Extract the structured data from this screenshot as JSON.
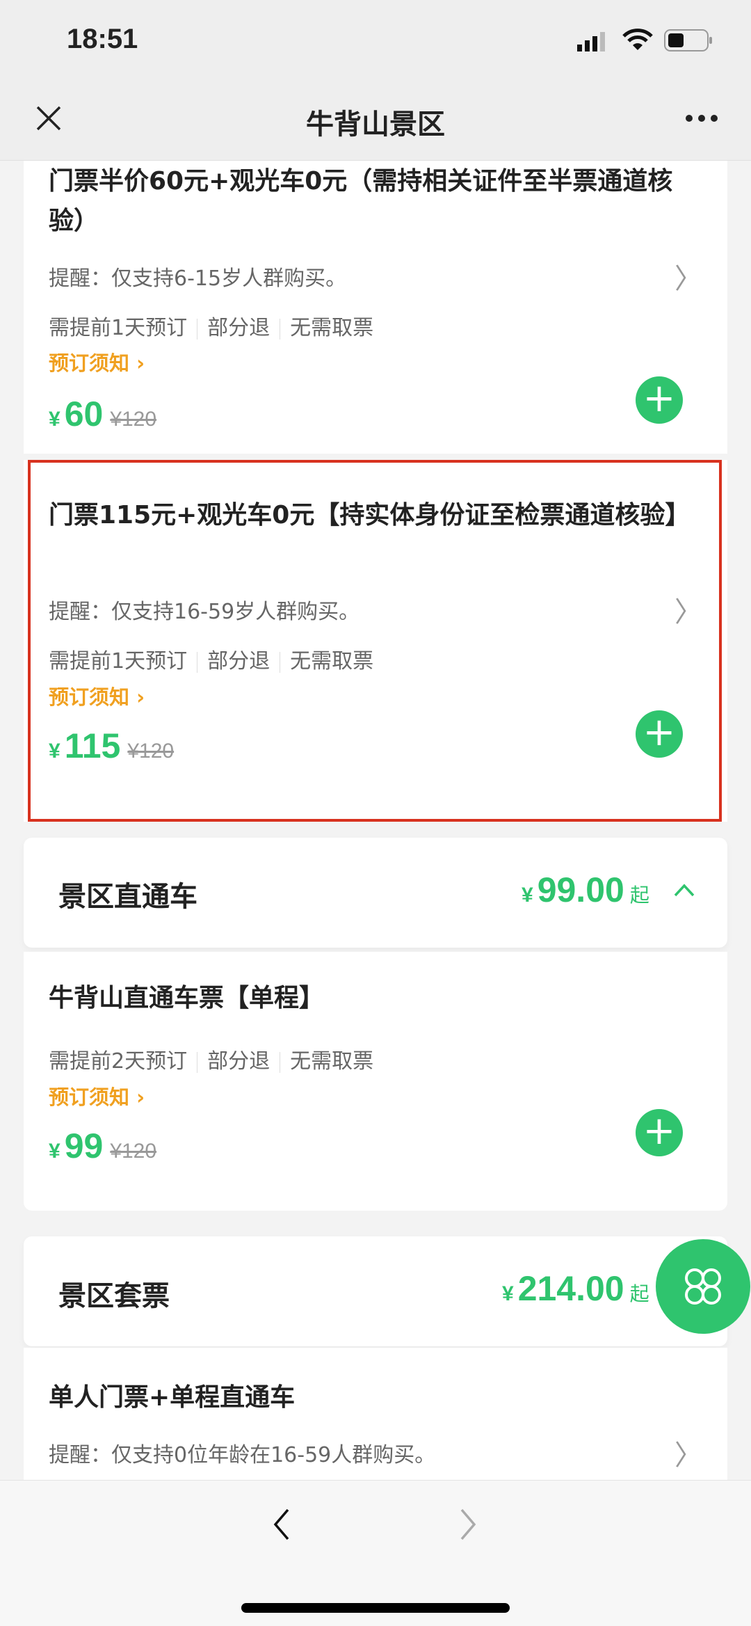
{
  "status_bar": {
    "time": "18:51"
  },
  "nav": {
    "title": "牛背山景区",
    "close_icon": "close-icon",
    "more_icon": "more-icon"
  },
  "colors": {
    "accent": "#2fc46e",
    "notice": "#f0a020",
    "highlight_border": "#d8321f"
  },
  "tickets": [
    {
      "title": "门票半价60元+观光车0元（需持相关证件至半票通道核验）",
      "reminder": "提醒：仅支持6-15岁人群购买。",
      "tags": [
        "需提前1天预订",
        "部分退",
        "无需取票"
      ],
      "notice": "预订须知",
      "currency": "¥",
      "price": "60",
      "original": "¥120"
    },
    {
      "title": "门票115元+观光车0元【持实体身份证至检票通道核验】",
      "reminder": "提醒：仅支持16-59岁人群购买。",
      "tags": [
        "需提前1天预订",
        "部分退",
        "无需取票"
      ],
      "notice": "预订须知",
      "currency": "¥",
      "price": "115",
      "original": "¥120"
    }
  ],
  "sections": [
    {
      "title": "景区直通车",
      "currency": "¥",
      "price": "99.00",
      "suffix": "起",
      "items": [
        {
          "title": "牛背山直通车票【单程】",
          "tags": [
            "需提前2天预订",
            "部分退",
            "无需取票"
          ],
          "notice": "预订须知",
          "currency": "¥",
          "price": "99",
          "original": "¥120"
        }
      ]
    },
    {
      "title": "景区套票",
      "currency": "¥",
      "price": "214.00",
      "suffix": "起",
      "items": [
        {
          "title": "单人门票+单程直通车",
          "reminder": "提醒：仅支持0位年龄在16-59人群购买。"
        }
      ]
    }
  ]
}
